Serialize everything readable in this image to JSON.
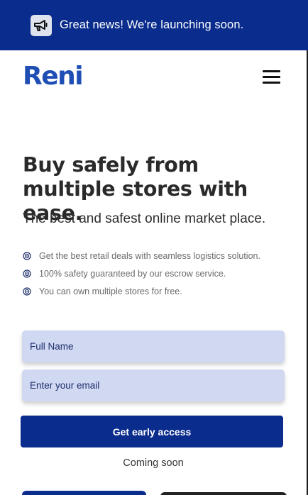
{
  "announcement": {
    "icon": "megaphone-icon",
    "text": "Great news! We're launching soon."
  },
  "header": {
    "logo": "Reni",
    "menu_icon": "hamburger-menu-icon"
  },
  "hero": {
    "title": "Buy safely from multiple stores with ease.",
    "subtitle": "The best and safest online market place.",
    "features": [
      "Get the best retail deals with seamless logistics solution.",
      "100% safety guaranteed by our escrow service.",
      "You can own multiple stores for free."
    ]
  },
  "form": {
    "name_placeholder": "Full Name",
    "email_placeholder": "Enter your email",
    "submit_label": "Get early access",
    "note": "Coming soon"
  },
  "colors": {
    "brand_navy": "#0a2c8c",
    "logo_blue": "#1f4fb5",
    "field_bg": "#d0d8f2"
  }
}
